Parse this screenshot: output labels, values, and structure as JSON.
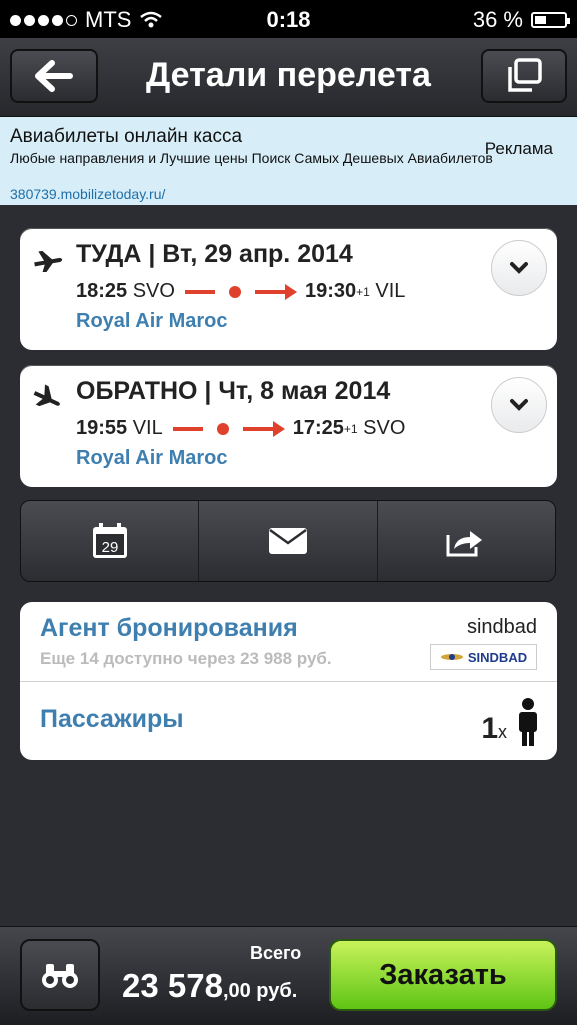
{
  "status": {
    "carrier": "MTS",
    "time": "0:18",
    "battery": "36 %"
  },
  "nav": {
    "title": "Детали перелета"
  },
  "ad": {
    "title": "Авиабилеты онлайн касса",
    "text": "Любые направления и Лучшие цены Поиск Самых Дешевых Авиабилетов",
    "url": "380739.mobilizetoday.ru/",
    "badge": "Реклама"
  },
  "outbound": {
    "header": "ТУДА | Вт, 29 апр. 2014",
    "dep_time": "18:25",
    "dep_airport": "SVO",
    "arr_time": "19:30",
    "arr_offset": "+1",
    "arr_airport": "VIL",
    "airline": "Royal Air Maroc"
  },
  "return": {
    "header": "ОБРАТНО | Чт, 8 мая 2014",
    "dep_time": "19:55",
    "dep_airport": "VIL",
    "arr_time": "17:25",
    "arr_offset": "+1",
    "arr_airport": "SVO",
    "airline": "Royal Air Maroc"
  },
  "actions": {
    "calendar_day": "29"
  },
  "booking": {
    "label": "Агент бронирования",
    "sub": "Еще 14 доступно через 23 988 руб.",
    "agent": "sindbad",
    "logo_text": "SINDBAD"
  },
  "passengers": {
    "label": "Пассажиры",
    "count": "1",
    "x": "x"
  },
  "bottom": {
    "total_label": "Всего",
    "price_main": "23 578",
    "price_cents": ",00 руб.",
    "order_label": "Заказать"
  }
}
